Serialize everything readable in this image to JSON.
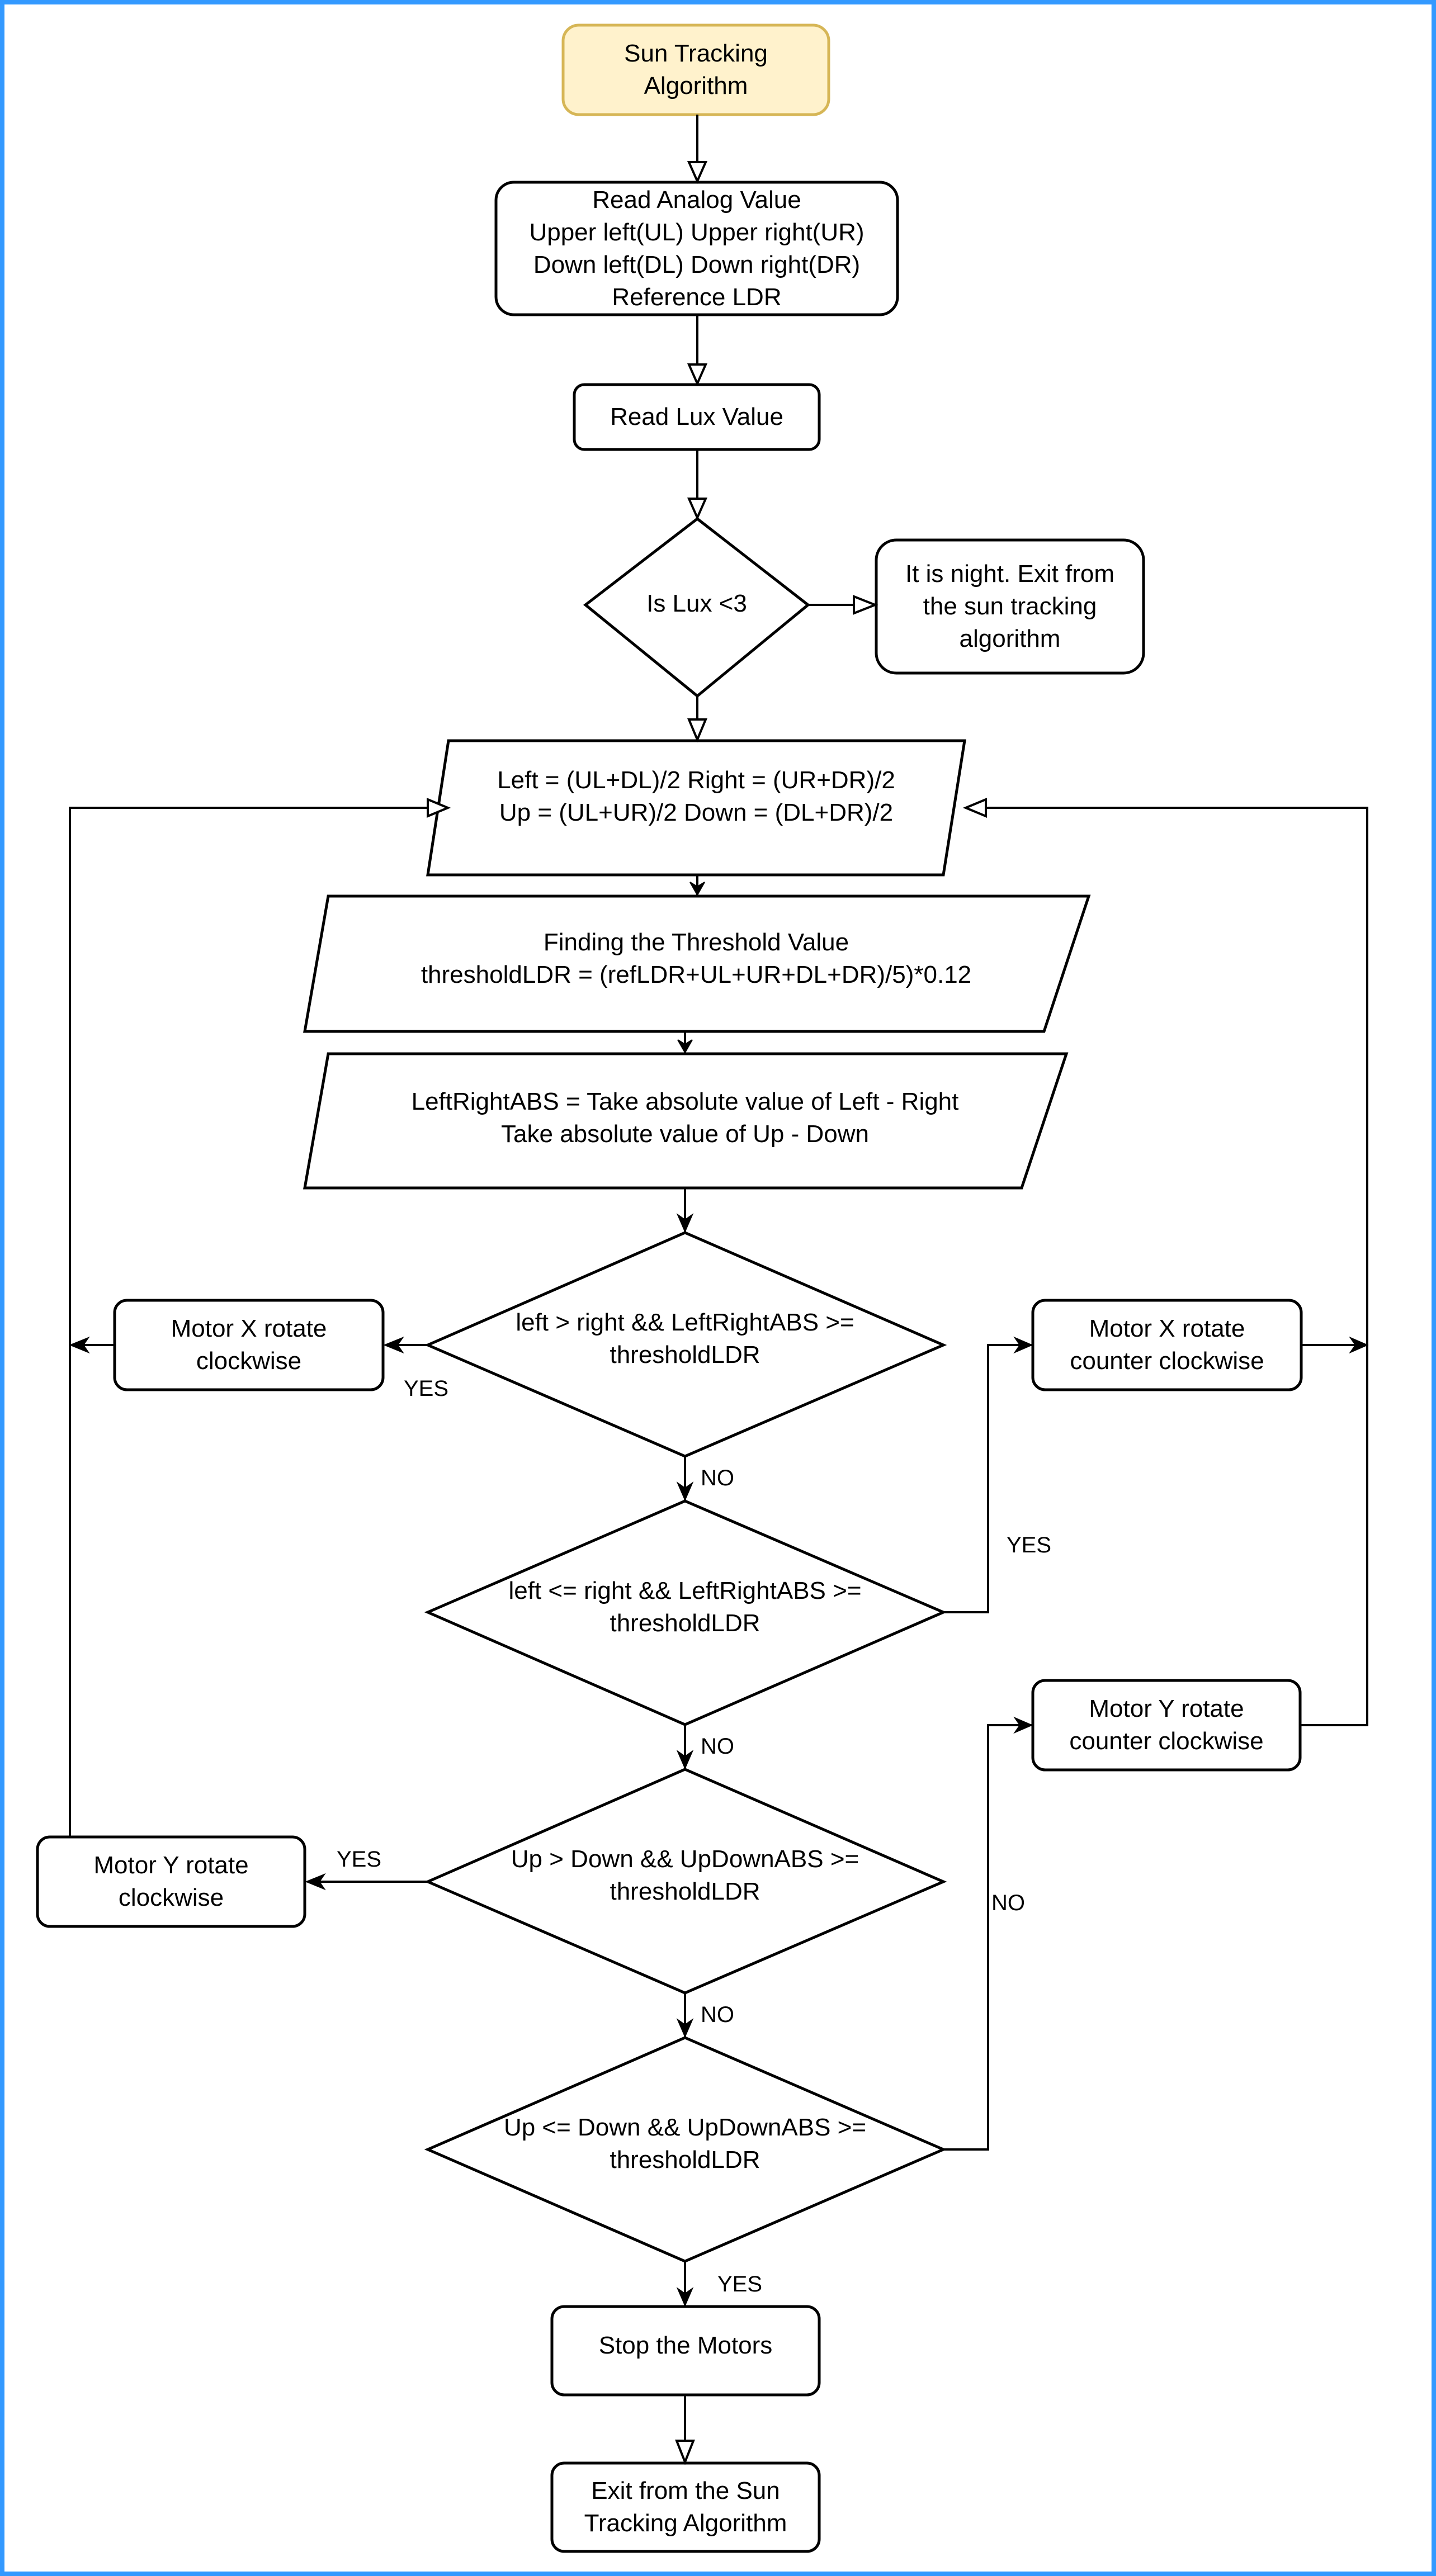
{
  "diagram": {
    "title": "Sun Tracking Algorithm",
    "colors": {
      "frame_border": "#3399ff",
      "start_fill": "#fff2cc",
      "start_stroke": "#d6b656",
      "shape_stroke": "#000000"
    },
    "nodes": {
      "start": "Sun Tracking\nAlgorithm",
      "read_analog": "Read Analog Value\nUpper left(UL) Upper right(UR)\nDown left(DL) Down right(DR)\nReference LDR",
      "read_lux": "Read Lux Value",
      "lux_check": "Is Lux <3",
      "night_exit": "It is night. Exit from\nthe sun tracking\nalgorithm",
      "averages": "Left = (UL+DL)/2  Right = (UR+DR)/2\nUp = (UL+UR)/2 Down = (DL+DR)/2",
      "threshold": "Finding the Threshold Value\nthresholdLDR = (refLDR+UL+UR+DL+DR)/5)*0.12",
      "abs_values": "LeftRightABS = Take absolute value of Left - Right\nTake absolute value of Up - Down",
      "cond_left_gt_right": "left > right && LeftRightABS >=\nthresholdLDR",
      "motor_x_cw": "Motor X rotate\nclockwise",
      "motor_x_ccw": "Motor X rotate\ncounter clockwise",
      "cond_left_le_right": "left <= right && LeftRightABS >=\nthresholdLDR",
      "motor_y_ccw": "Motor Y rotate\ncounter clockwise",
      "cond_up_gt_down": "Up > Down && UpDownABS >=\nthresholdLDR",
      "motor_y_cw": "Motor Y rotate\nclockwise",
      "cond_up_le_down": "Up <= Down && UpDownABS >=\nthresholdLDR",
      "stop_motors": "Stop the Motors",
      "exit": "Exit from the Sun\nTracking Algorithm"
    },
    "edge_labels": {
      "yes_motor_x_cw": "YES",
      "no_after_cond1": "NO",
      "yes_motor_x_ccw": "YES",
      "no_after_cond2": "NO",
      "yes_motor_y_cw": "YES",
      "no_after_cond3": "NO",
      "no_motor_y_ccw": "NO",
      "yes_stop": "YES"
    }
  }
}
